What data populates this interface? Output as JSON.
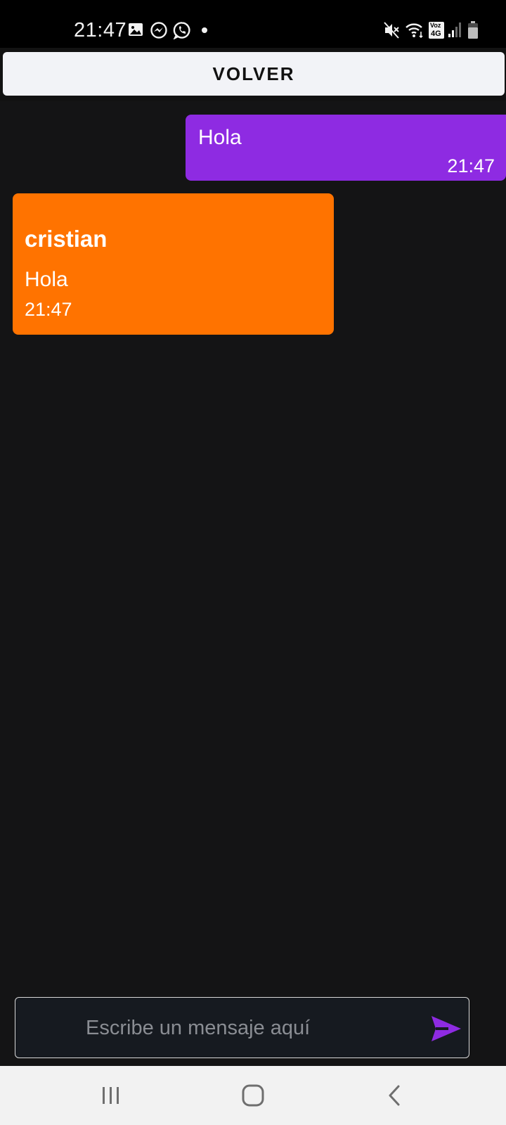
{
  "status_bar": {
    "time": "21:47",
    "icons": [
      "gallery-icon",
      "messenger-icon",
      "whatsapp-icon",
      "dot-icon",
      "mute-icon",
      "wifi-icon",
      "volte-4g-icon",
      "signal-icon",
      "battery-icon"
    ],
    "volte_label": "Voz",
    "network_label": "4G"
  },
  "header": {
    "back_label": "VOLVER"
  },
  "messages": [
    {
      "type": "sent",
      "text": "Hola",
      "time": "21:47",
      "color": "#8e2be2"
    },
    {
      "type": "received",
      "sender": "cristian",
      "text": "Hola",
      "time": "21:47",
      "color": "#ff7300"
    }
  ],
  "composer": {
    "placeholder": "Escribe un mensaje aquí",
    "value": "",
    "send_icon": "send-icon",
    "send_color": "#8e2be2"
  },
  "nav_bar": {
    "icons": [
      "recent-apps-icon",
      "home-icon",
      "back-icon"
    ]
  }
}
